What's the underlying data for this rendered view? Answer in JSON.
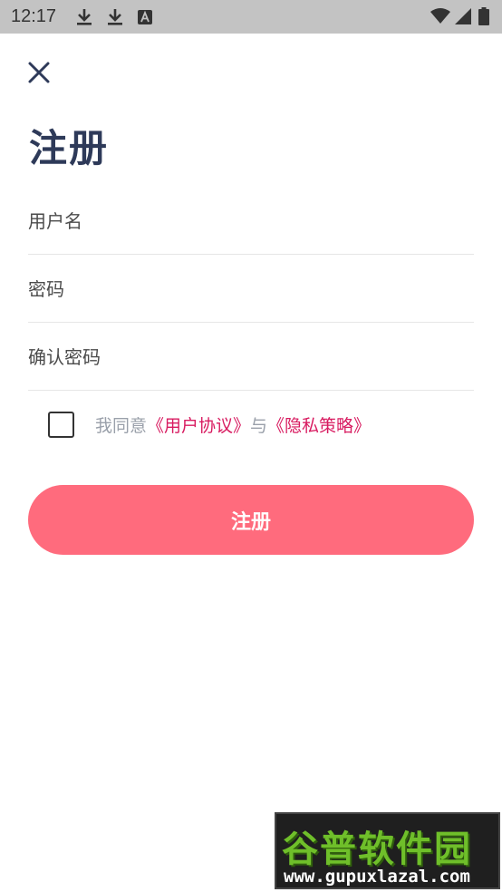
{
  "status_bar": {
    "time": "12:17",
    "icons": [
      "download-icon",
      "download-icon",
      "text-a-icon",
      "wifi-icon",
      "signal-icon",
      "battery-icon"
    ]
  },
  "header": {
    "close_icon": "close-icon"
  },
  "title": "注册",
  "form": {
    "username_placeholder": "用户名",
    "password_placeholder": "密码",
    "confirm_placeholder": "确认密码",
    "agree_prefix": "我同意",
    "agree_link1": "《用户协议》",
    "agree_and": "与",
    "agree_link2": "《隐私策略》",
    "checked": false,
    "submit_label": "注册"
  },
  "colors": {
    "title": "#2e3a59",
    "link": "#d81b60",
    "button": "#ff6b7d"
  },
  "watermark": {
    "top": "谷普软件园",
    "bottom": "www.gupuxlazal.com"
  }
}
